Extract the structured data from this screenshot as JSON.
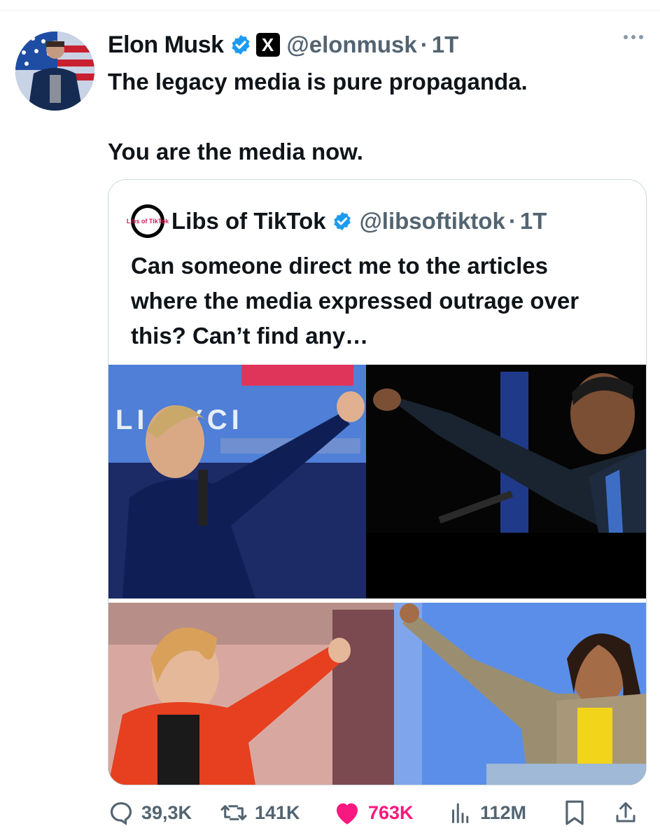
{
  "author": {
    "name": "Elon Musk",
    "handle": "@elonmusk",
    "separator": "·",
    "time": "1T",
    "verified_icon": "verified-badge-icon",
    "affiliate_icon": "x-logo-icon",
    "affiliate_label": "X"
  },
  "tweet": {
    "lines": [
      "The legacy media is pure propaganda.",
      "You are the media now."
    ]
  },
  "quoted": {
    "name": "Libs of TikTok",
    "handle": "@libsoftiktok",
    "separator": "·",
    "time": "1T",
    "avatar_text": "Libs of TikTok",
    "text": "Can someone direct me to the articles where the media expressed outrage over this? Can’t find any…",
    "image_sign_text": "LI RYCI"
  },
  "actions": {
    "replies": "39,3K",
    "reposts": "141K",
    "likes": "763K",
    "views": "112M"
  },
  "colors": {
    "accent": "#1d9bf0",
    "like": "#f91880",
    "secondary_text": "#536471",
    "border": "#cfd9de"
  }
}
